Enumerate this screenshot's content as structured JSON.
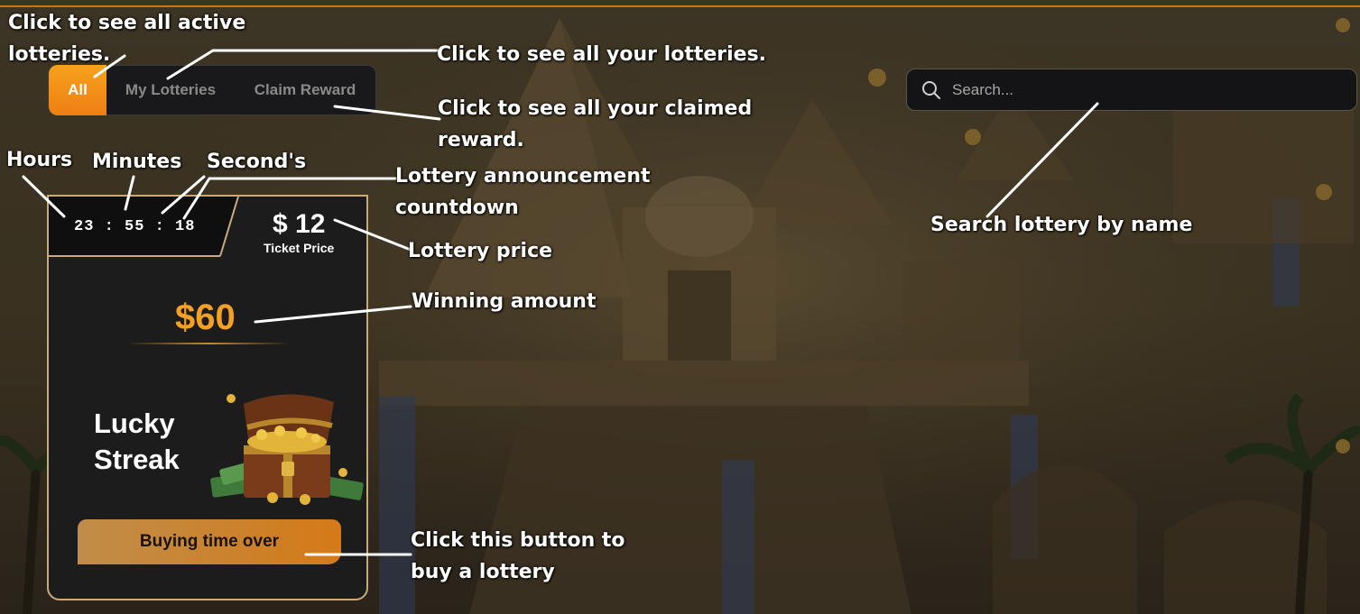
{
  "tabs": {
    "all": "All",
    "my_lotteries": "My Lotteries",
    "claim_reward": "Claim Reward",
    "active_color": "#f59a1c"
  },
  "search": {
    "placeholder": "Search..."
  },
  "card": {
    "timer": "23 : 55 : 18",
    "price": "$ 12",
    "price_label": "Ticket Price",
    "prize": "$60",
    "name_line1": "Lucky",
    "name_line2": "Streak",
    "button": "Buying time over",
    "accent": "#f3a024",
    "border": "#c9aa7a"
  },
  "annotations": {
    "all_tab_1": "Click to see all active",
    "all_tab_2": "lotteries.",
    "my_lotteries": "Click to see all your lotteries.",
    "claimed_1": "Click to see all your claimed",
    "claimed_2": "reward.",
    "hours": "Hours",
    "minutes": "Minutes",
    "seconds": "Second's",
    "countdown_1": "Lottery announcement",
    "countdown_2": "countdown",
    "search": "Search lottery by name",
    "price": "Lottery price",
    "winning": "Winning amount",
    "buy_1": "Click this button to",
    "buy_2": "buy a lottery"
  }
}
